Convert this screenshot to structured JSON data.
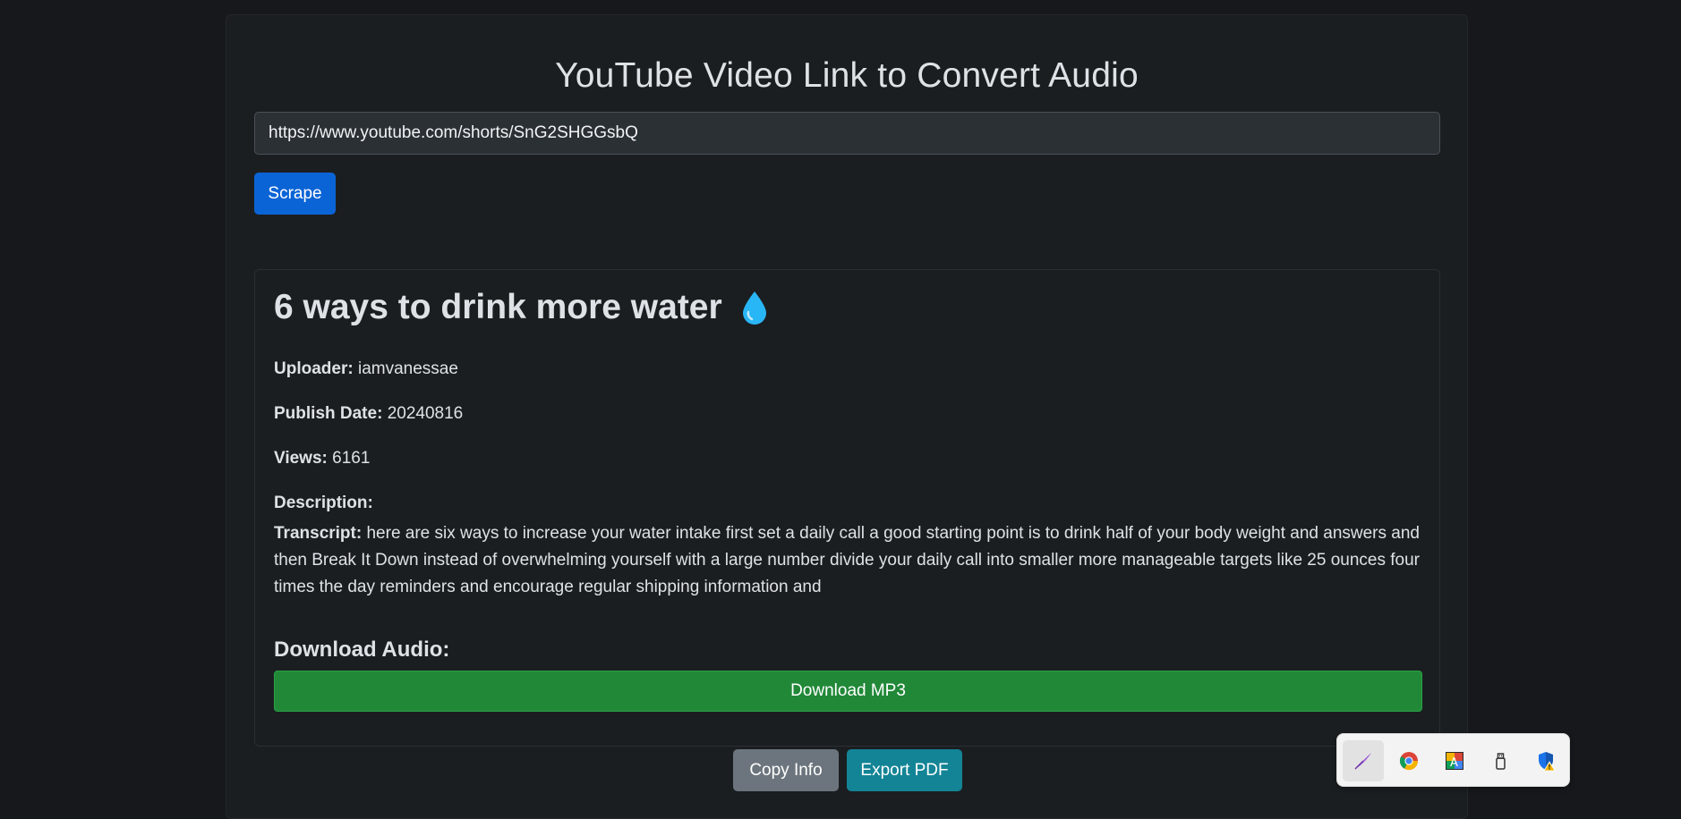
{
  "page": {
    "title": "YouTube Video Link to Convert Audio"
  },
  "form": {
    "url_value": "https://www.youtube.com/shorts/SnG2SHGGsbQ",
    "scrape_label": "Scrape"
  },
  "video": {
    "title": "6 ways to drink more water",
    "title_icon": "water-drop-icon",
    "uploader_label": "Uploader:",
    "uploader": "iamvanessae",
    "publish_date_label": "Publish Date:",
    "publish_date": "20240816",
    "views_label": "Views:",
    "views": "6161",
    "description_label": "Description:",
    "description": "",
    "transcript_label": "Transcript:",
    "transcript": "here are six ways to increase your water intake first set a daily call a good starting point is to drink half of your body weight and answers and then Break It Down instead of overwhelming yourself with a large number divide your daily call into smaller more manageable targets like 25 ounces four times the day reminders and encourage regular shipping information and"
  },
  "download": {
    "heading": "Download Audio:",
    "mp3_label": "Download MP3"
  },
  "actions": {
    "copy_label": "Copy Info",
    "export_label": "Export PDF"
  },
  "tray": {
    "icons": [
      "feather-pen-icon",
      "chrome-icon",
      "paint-app-icon",
      "usb-drive-icon",
      "security-shield-icon"
    ]
  },
  "colors": {
    "primary": "#0b64d6",
    "success": "#218838",
    "secondary": "#6c757d",
    "info": "#138496",
    "background": "#16181b"
  }
}
